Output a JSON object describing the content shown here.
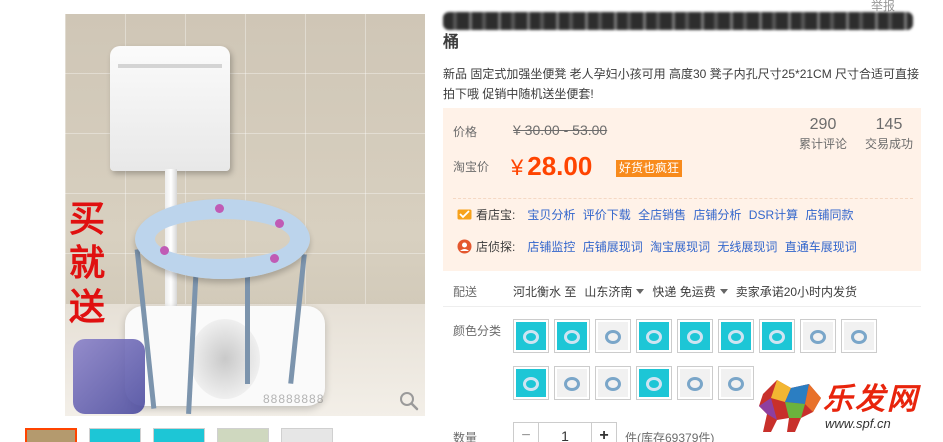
{
  "product": {
    "title": "专用加厚防滑孕妇老人儿童坐便凳坐便器坐厕椅蹲坑坐具子移动马桶",
    "title_tail": "桶",
    "subtitle": "新品 固定式加强坐便凳 老人孕妇小孩可用 高度30 凳子内孔尺寸25*21CM 尺寸合适可直接拍下哦 促销中随机送坐便套!",
    "report_link": "举报"
  },
  "image": {
    "promo_text": "买就送",
    "watermark": "88888888"
  },
  "price": {
    "label": "价格",
    "original": "¥ 30.00 - 53.00",
    "taobao_label": "淘宝价",
    "currency": "¥",
    "current": "28.00",
    "badge": "好货也疯狂"
  },
  "stats": {
    "reviews_count": "290",
    "reviews_label": "累计评论",
    "sales_count": "145",
    "sales_label": "交易成功"
  },
  "tools": {
    "row1": {
      "name": "看店宝:",
      "links": [
        "宝贝分析",
        "评价下载",
        "全店销售",
        "店铺分析",
        "DSR计算",
        "店铺同款"
      ]
    },
    "row2": {
      "name": "店侦探:",
      "links": [
        "店铺监控",
        "店铺展现词",
        "淘宝展现词",
        "无线展现词",
        "直通车展现词"
      ]
    }
  },
  "delivery": {
    "label": "配送",
    "from": "河北衡水 至",
    "to": "山东济南",
    "method": "快递 免运费",
    "promise": "卖家承诺20小时内发货"
  },
  "variants": {
    "label": "颜色分类",
    "swatches": [
      "cyan",
      "cyan",
      "white",
      "cyan",
      "cyan",
      "cyan",
      "cyan",
      "white",
      "white",
      "cyan",
      "white",
      "white",
      "cyan",
      "white",
      "white"
    ]
  },
  "quantity": {
    "label": "数量",
    "minus": "−",
    "value": "1",
    "plus": "+",
    "stock_text": "件(库存69379件)"
  },
  "site": {
    "brand": "乐发网",
    "url": "www.spf.cn"
  },
  "colors": {
    "price": "#ff4400",
    "badge": "#f88b1c",
    "link": "#3366cc",
    "price_bg": "#fff2e8"
  }
}
